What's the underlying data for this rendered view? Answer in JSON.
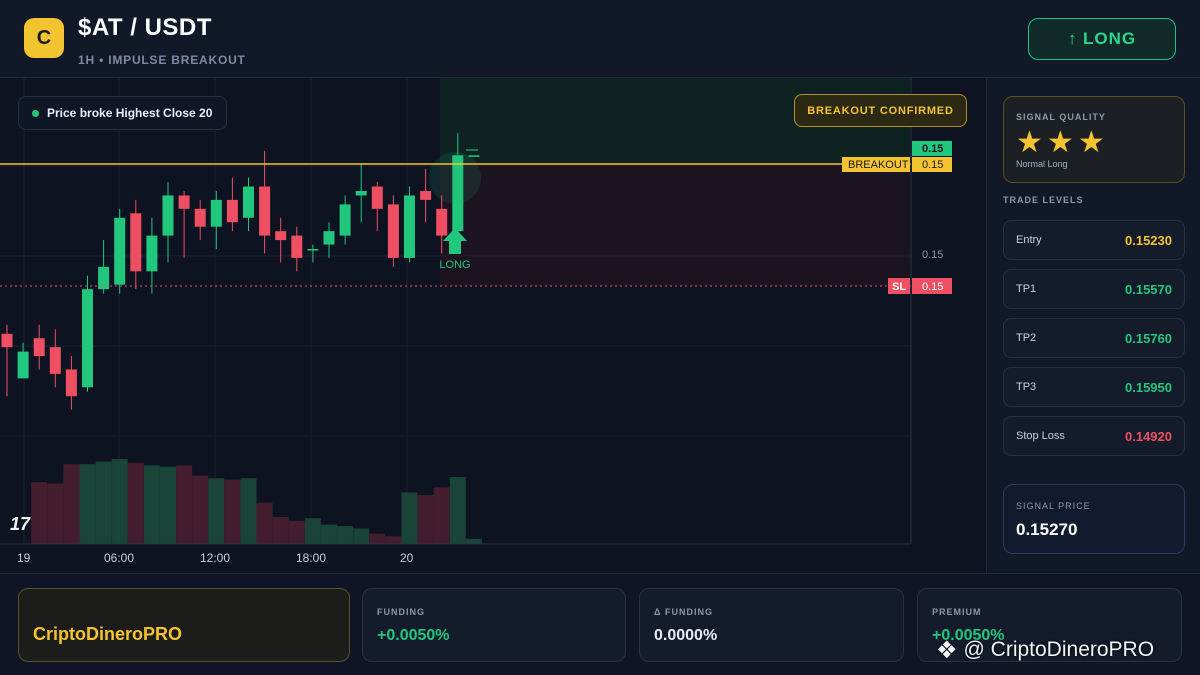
{
  "header": {
    "logo_letter": "C",
    "pair": "$AT / USDT",
    "subtitle": "1H • IMPULSE BREAKOUT",
    "direction_button": "↑ LONG"
  },
  "chart": {
    "info_pill": "Price broke Highest Close 20",
    "breakout_badge": "BREAKOUT CONFIRMED",
    "tv_logo": "17",
    "signal_marker_label": "LONG",
    "breakout_line_label": "BREAKOUT",
    "breakout_line_value": "0.15",
    "stop_line_label": "SL",
    "stop_line_value": "0.15",
    "last_price_label": "0.15",
    "price_scale_tick": "0.15",
    "colors": {
      "up": "#22c77e",
      "down": "#ef4f62",
      "breakout": "#f4c430",
      "stop": "#ef4f62"
    }
  },
  "chart_data": {
    "type": "candlestick",
    "timeframe": "1H",
    "x_tick_labels": [
      "19",
      "06:00",
      "12:00",
      "18:00",
      "20"
    ],
    "y_tick_labels": [
      "0.15"
    ],
    "levels": {
      "entry": 0.1523,
      "tp1": 0.1557,
      "tp2": 0.1576,
      "tp3": 0.1595,
      "stop_loss": 0.1492,
      "signal_price": 0.1527
    },
    "candles": [
      {
        "o": 0.15,
        "h": 0.1502,
        "c": 0.1497,
        "l": 0.1486
      },
      {
        "o": 0.149,
        "h": 0.1498,
        "c": 0.1496,
        "l": 0.1492
      },
      {
        "o": 0.1499,
        "h": 0.1502,
        "c": 0.1495,
        "l": 0.1492
      },
      {
        "o": 0.1497,
        "h": 0.1501,
        "c": 0.1491,
        "l": 0.1488
      },
      {
        "o": 0.1492,
        "h": 0.1495,
        "c": 0.1486,
        "l": 0.1483
      },
      {
        "o": 0.1488,
        "h": 0.1513,
        "c": 0.151,
        "l": 0.1487
      },
      {
        "o": 0.151,
        "h": 0.1521,
        "c": 0.1515,
        "l": 0.1509
      },
      {
        "o": 0.1511,
        "h": 0.1528,
        "c": 0.1526,
        "l": 0.1509
      },
      {
        "o": 0.1527,
        "h": 0.153,
        "c": 0.1514,
        "l": 0.151
      },
      {
        "o": 0.1514,
        "h": 0.1526,
        "c": 0.1522,
        "l": 0.1509
      },
      {
        "o": 0.1522,
        "h": 0.1534,
        "c": 0.1531,
        "l": 0.1516
      },
      {
        "o": 0.1531,
        "h": 0.1532,
        "c": 0.1528,
        "l": 0.1517
      },
      {
        "o": 0.1528,
        "h": 0.153,
        "c": 0.1524,
        "l": 0.1521
      },
      {
        "o": 0.1524,
        "h": 0.1532,
        "c": 0.153,
        "l": 0.1519
      },
      {
        "o": 0.153,
        "h": 0.1535,
        "c": 0.1525,
        "l": 0.1523
      },
      {
        "o": 0.1526,
        "h": 0.1535,
        "c": 0.1533,
        "l": 0.1523
      },
      {
        "o": 0.1533,
        "h": 0.1541,
        "c": 0.1522,
        "l": 0.1518
      },
      {
        "o": 0.1523,
        "h": 0.1526,
        "c": 0.1521,
        "l": 0.1516
      },
      {
        "o": 0.1522,
        "h": 0.1524,
        "c": 0.1517,
        "l": 0.1514
      },
      {
        "o": 0.1519,
        "h": 0.152,
        "c": 0.1519,
        "l": 0.1516
      },
      {
        "o": 0.152,
        "h": 0.1525,
        "c": 0.1523,
        "l": 0.1517
      },
      {
        "o": 0.1522,
        "h": 0.1531,
        "c": 0.1529,
        "l": 0.152
      },
      {
        "o": 0.1531,
        "h": 0.1538,
        "c": 0.1532,
        "l": 0.1525
      },
      {
        "o": 0.1533,
        "h": 0.1534,
        "c": 0.1528,
        "l": 0.1523
      },
      {
        "o": 0.1529,
        "h": 0.1531,
        "c": 0.1517,
        "l": 0.1515
      },
      {
        "o": 0.1517,
        "h": 0.1533,
        "c": 0.1531,
        "l": 0.1516
      },
      {
        "o": 0.1532,
        "h": 0.1537,
        "c": 0.153,
        "l": 0.1525
      },
      {
        "o": 0.1528,
        "h": 0.1531,
        "c": 0.1522,
        "l": 0.1518
      },
      {
        "o": 0.1523,
        "h": 0.1545,
        "c": 0.154,
        "l": 0.1523
      },
      {
        "o": 0.154,
        "h": 0.154,
        "c": 0.154,
        "l": 0.154
      }
    ],
    "volume": [
      0,
      0,
      48,
      47,
      62,
      62,
      64,
      66,
      63,
      61,
      60,
      61,
      53,
      51,
      50,
      51,
      32,
      21,
      18,
      20,
      15,
      14,
      12,
      8,
      6,
      40,
      38,
      44,
      52,
      4
    ],
    "grid": true
  },
  "sidebar": {
    "quality_label": "SIGNAL QUALITY",
    "stars": 3,
    "quality_note": "Normal Long",
    "levels_title": "TRADE LEVELS",
    "levels": [
      {
        "name": "Entry",
        "value": "0.15230",
        "color": "#f4c430"
      },
      {
        "name": "TP1",
        "value": "0.15570",
        "color": "#22c77e"
      },
      {
        "name": "TP2",
        "value": "0.15760",
        "color": "#22c77e"
      },
      {
        "name": "TP3",
        "value": "0.15950",
        "color": "#22c77e"
      },
      {
        "name": "Stop Loss",
        "value": "0.14920",
        "color": "#ef4f62"
      }
    ],
    "signal_price_label": "SIGNAL PRICE",
    "signal_price_value": "0.15270"
  },
  "footer": {
    "brand": "CriptoDineroPRO",
    "metrics": [
      {
        "label": "FUNDING",
        "value": "+0.0050%",
        "color": "#22c77e"
      },
      {
        "label": "Δ FUNDING",
        "value": "0.0000%",
        "color": "#e6ebf5"
      },
      {
        "label": "PREMIUM",
        "value": "+0.0050%",
        "color": "#22c77e"
      }
    ],
    "watermark": "@ CriptoDineroPRO"
  }
}
